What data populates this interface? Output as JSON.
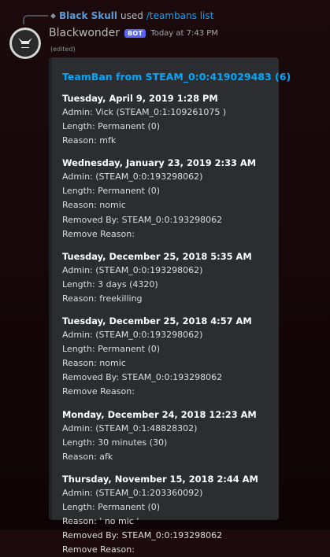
{
  "reply": {
    "user": "Black Skull",
    "verb": "used",
    "command": "/teambans list"
  },
  "message": {
    "username": "Blackwonder",
    "bot_tag": "BOT",
    "timestamp": "Today at 7:43 PM",
    "edited": "(edited)"
  },
  "embed": {
    "title": "TeamBan from STEAM_0:0:419029483 (6)",
    "entries": [
      {
        "date": "Tuesday, April 9, 2019 1:28 PM",
        "lines": [
          "Admin: Vick (STEAM_0:1:109261075 )",
          "Length: Permanent (0)",
          "Reason: mfk"
        ]
      },
      {
        "date": "Wednesday, January 23, 2019 2:33 AM",
        "lines": [
          "Admin: (STEAM_0:0:193298062)",
          "Length: Permanent (0)",
          "Reason: nomic",
          "Removed By: STEAM_0:0:193298062",
          "Remove Reason:"
        ]
      },
      {
        "date": "Tuesday, December 25, 2018 5:35 AM",
        "lines": [
          "Admin: (STEAM_0:0:193298062)",
          "Length: 3 days (4320)",
          "Reason: freekilling"
        ]
      },
      {
        "date": "Tuesday, December 25, 2018 4:57 AM",
        "lines": [
          "Admin: (STEAM_0:0:193298062)",
          "Length: Permanent (0)",
          "Reason: nomic",
          "Removed By: STEAM_0:0:193298062",
          "Remove Reason:"
        ]
      },
      {
        "date": "Monday, December 24, 2018 12:23 AM",
        "lines": [
          "Admin: (STEAM_0:1:48828302)",
          "Length: 30 minutes (30)",
          "Reason: afk"
        ]
      },
      {
        "date": "Thursday, November 15, 2018 2:44 AM",
        "lines": [
          "Admin: (STEAM_0:1:203360092)",
          "Length: Permanent (0)",
          "Reason: ' no mic '",
          "Removed By: STEAM_0:0:193298062",
          "Remove Reason:"
        ]
      }
    ]
  }
}
